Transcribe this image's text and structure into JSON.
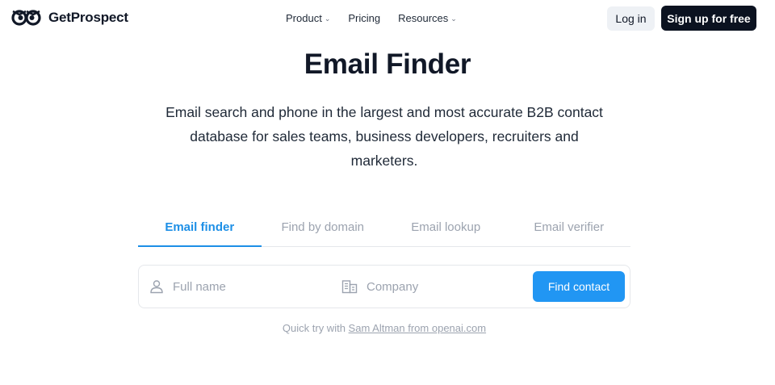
{
  "brand": {
    "name": "GetProspect"
  },
  "nav": {
    "items": [
      {
        "label": "Product",
        "has_dropdown": true
      },
      {
        "label": "Pricing",
        "has_dropdown": false
      },
      {
        "label": "Resources",
        "has_dropdown": true
      }
    ],
    "login_label": "Log in",
    "signup_label": "Sign up for free"
  },
  "hero": {
    "title": "Email Finder",
    "subtitle": "Email search and phone in the largest and most accurate B2B contact database for sales teams, business developers, recruiters and marketers."
  },
  "tabs": [
    {
      "label": "Email finder",
      "active": true
    },
    {
      "label": "Find by domain",
      "active": false
    },
    {
      "label": "Email lookup",
      "active": false
    },
    {
      "label": "Email verifier",
      "active": false
    }
  ],
  "search": {
    "name_placeholder": "Full name",
    "company_placeholder": "Company",
    "submit_label": "Find contact"
  },
  "quick_try": {
    "prefix": "Quick try with",
    "link_label": "Sam Altman from openai.com"
  },
  "colors": {
    "accent": "#1d8fe6",
    "button_primary": "#2196f3",
    "button_dark": "#0b1220"
  },
  "icons": {
    "logo": "owl-eyes-icon",
    "chevron": "chevron-down-icon",
    "person": "user-icon",
    "building": "building-icon"
  }
}
